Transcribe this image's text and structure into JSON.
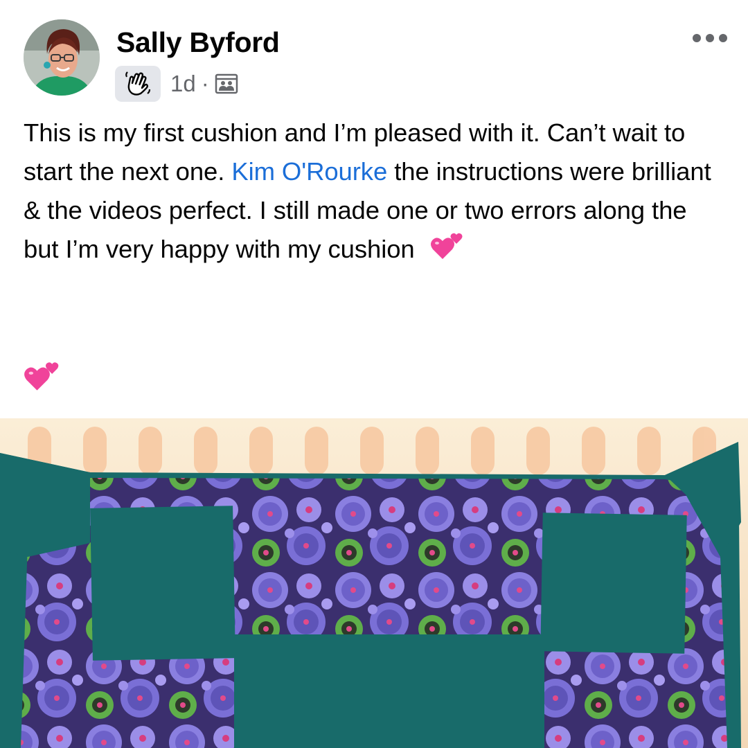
{
  "post": {
    "author": "Sally Byford",
    "time": "1d",
    "separator": "·",
    "badge_icon": "waving-hand-icon",
    "audience_icon": "group-audience-icon",
    "text_part1": "This is my first cushion and I’m pleased with it. Can’t wait to start the next one. ",
    "mention": "Kim O'Rourke",
    "text_part2": " the instructions were brilliant & the videos perfect. I still made one or two errors along the but I’m very happy with my cushion",
    "emoji_name": "two-hearts-icon",
    "accent_color": "#1b6ed8",
    "heart_color": "#f0439a"
  }
}
